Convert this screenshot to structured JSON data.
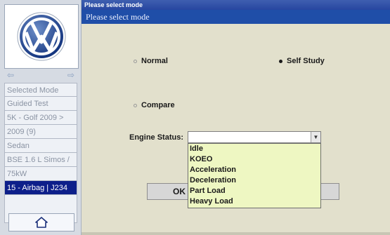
{
  "window": {
    "title": "Please select mode",
    "header": "Please select mode"
  },
  "sidebar": {
    "items": [
      "Selected Mode",
      "Guided Test",
      "5K - Golf  2009 >",
      "2009 (9)",
      "Sedan",
      "BSE 1.6 L Simos /",
      "75kW",
      "15 - Airbag | J234"
    ],
    "active_index": 7,
    "icons": {
      "home": "home-icon",
      "back": "arrow-left-icon",
      "forward": "arrow-right-icon",
      "logo": "vw-logo"
    }
  },
  "modes": {
    "normal": "Normal",
    "self_study": "Self Study",
    "compare": "Compare",
    "selected": "self_study"
  },
  "engine_status": {
    "label": "Engine Status:",
    "value": "",
    "options": [
      "Idle",
      "KOEO",
      "Acceleration",
      "Deceleration",
      "Part Load",
      "Heavy Load"
    ]
  },
  "buttons": {
    "ok": "OK"
  },
  "colors": {
    "header_blue": "#1f4ea8",
    "active_item": "#0d1f8a",
    "content_bg": "#e2e0cc",
    "dropdown_bg": "#eef7c2"
  }
}
